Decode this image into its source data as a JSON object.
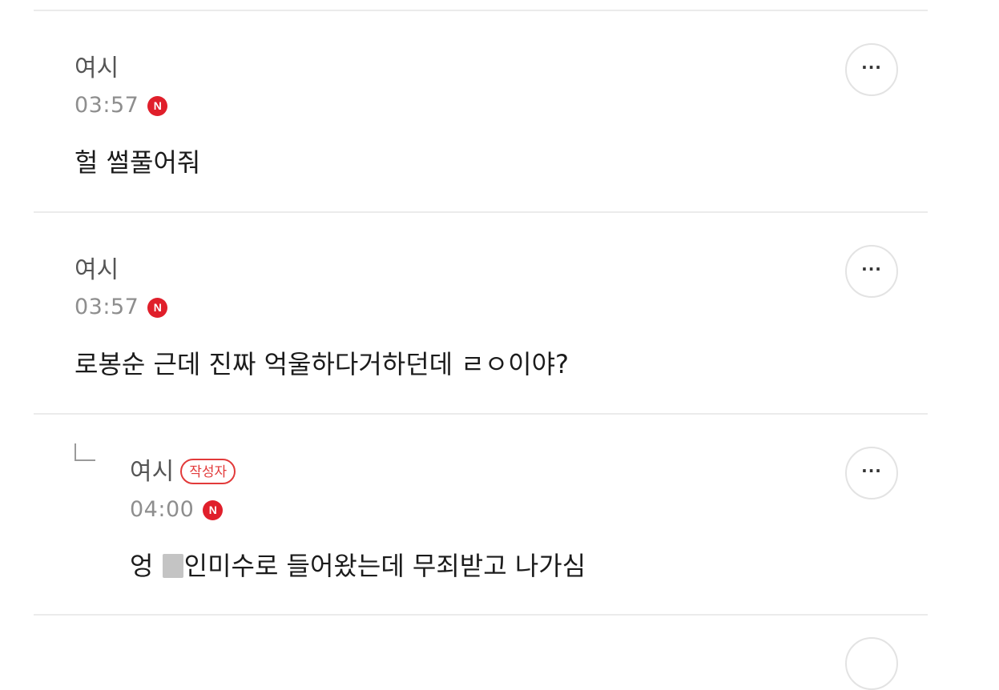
{
  "comments": [
    {
      "author": "여시",
      "time": "03:57",
      "new_badge": "N",
      "text": "헐 썰풀어줘",
      "more_label": "···"
    },
    {
      "author": "여시",
      "time": "03:57",
      "new_badge": "N",
      "text": "로봉순 근데 진짜 억울하다거하던데 ㄹㅇ이야?",
      "more_label": "···"
    },
    {
      "author": "여시",
      "author_badge": "작성자",
      "time": "04:00",
      "new_badge": "N",
      "text_before": "엉 ",
      "text_after": "인미수로 들어왔는데 무죄받고 나가심",
      "more_label": "···"
    }
  ],
  "colors": {
    "new_badge": "#e01f2b",
    "author_badge": "#e23a3a",
    "divider": "#ebebeb"
  },
  "icons": {
    "more": "more-horizontal-icon",
    "reply": "reply-arrow-icon"
  }
}
